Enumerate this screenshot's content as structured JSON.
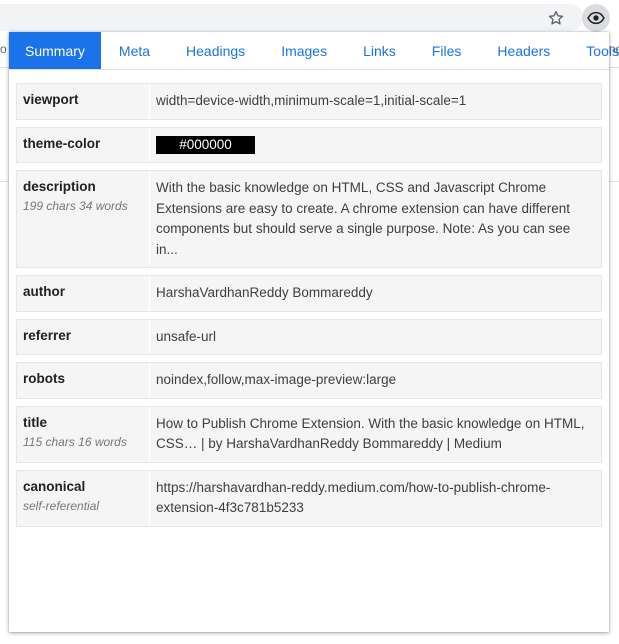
{
  "tabs": [
    {
      "label": "Summary",
      "active": true
    },
    {
      "label": "Meta"
    },
    {
      "label": "Headings"
    },
    {
      "label": "Images"
    },
    {
      "label": "Links"
    },
    {
      "label": "Files"
    },
    {
      "label": "Headers"
    },
    {
      "label": "Tools"
    }
  ],
  "background": {
    "left_fragment": "o",
    "right_fragment": "ng"
  },
  "rows": {
    "viewport": {
      "key": "viewport",
      "value": "width=device-width,minimum-scale=1,initial-scale=1"
    },
    "theme_color": {
      "key": "theme-color",
      "value": "#000000",
      "color": "#000000"
    },
    "description": {
      "key": "description",
      "sub": "199 chars  34 words",
      "value": "With the basic knowledge on HTML, CSS and Javascript Chrome Extensions are easy to create. A chrome extension can have different components but should serve a single purpose. Note: As you can see in..."
    },
    "author": {
      "key": "author",
      "value": "HarshaVardhanReddy Bommareddy"
    },
    "referrer": {
      "key": "referrer",
      "value": "unsafe-url"
    },
    "robots": {
      "key": "robots",
      "value": "noindex,follow,max-image-preview:large"
    },
    "title": {
      "key": "title",
      "sub": "115 chars  16 words",
      "value": "How to Publish Chrome Extension. With the basic knowledge on HTML, CSS… | by HarshaVardhanReddy Bommareddy | Medium"
    },
    "canonical": {
      "key": "canonical",
      "sub": "self-referential",
      "value": "https://harshavardhan-reddy.medium.com/how-to-publish-chrome-extension-4f3c781b5233"
    }
  },
  "icons": {
    "star": "star-icon",
    "extension": "eye-icon"
  },
  "colors": {
    "accent": "#1a73e8",
    "row_bg": "#f5f5f5"
  }
}
